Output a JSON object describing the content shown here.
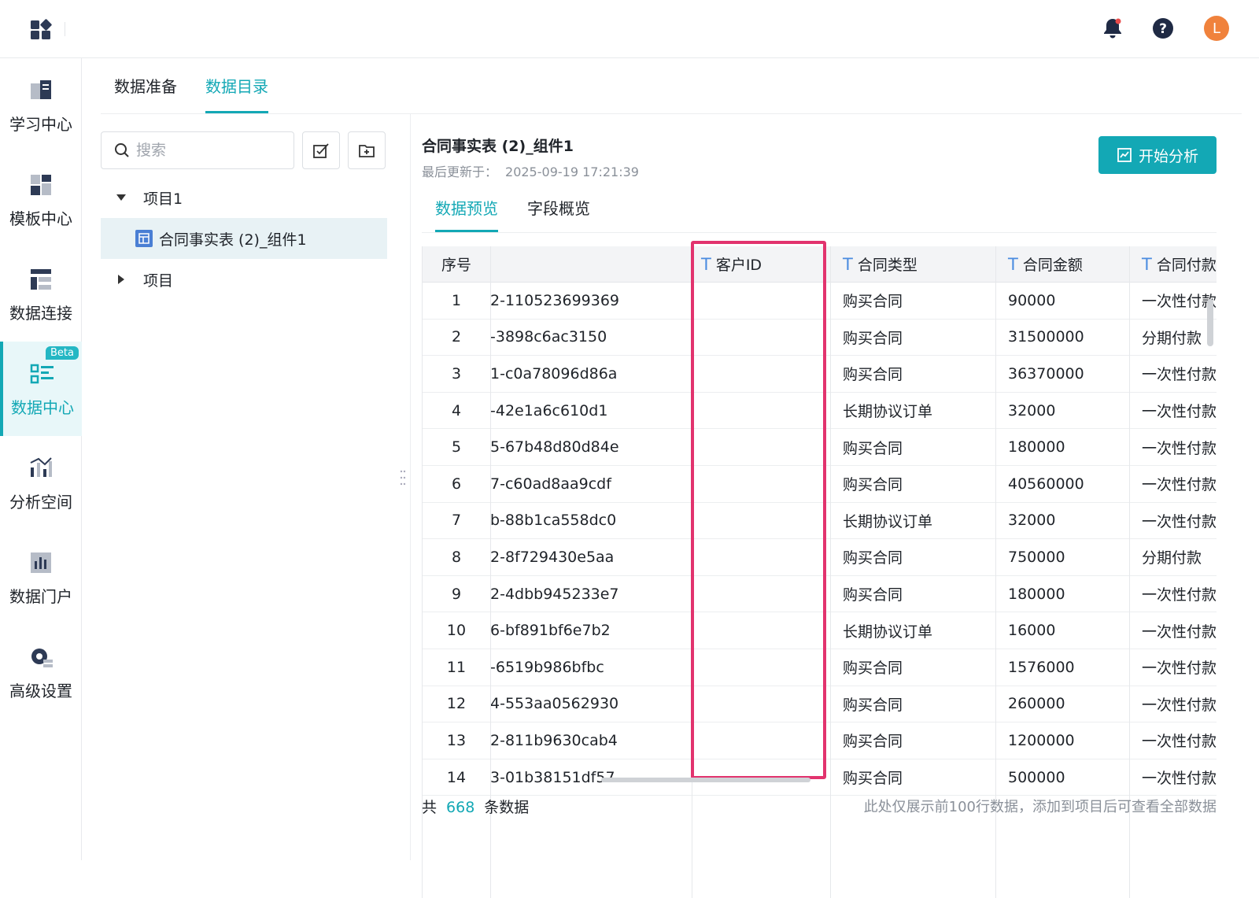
{
  "header": {
    "avatar_letter": "L"
  },
  "sidebar": {
    "items": [
      {
        "label": "学习中心",
        "icon": "book-icon"
      },
      {
        "label": "模板中心",
        "icon": "template-icon"
      },
      {
        "label": "数据连接",
        "icon": "data-connect-icon"
      },
      {
        "label": "数据中心",
        "icon": "data-center-icon",
        "badge": "Beta",
        "active": true
      },
      {
        "label": "分析空间",
        "icon": "analysis-icon"
      },
      {
        "label": "数据门户",
        "icon": "portal-icon"
      },
      {
        "label": "高级设置",
        "icon": "gear-icon"
      }
    ]
  },
  "top_tabs": [
    {
      "label": "数据准备"
    },
    {
      "label": "数据目录",
      "active": true
    }
  ],
  "left_panel": {
    "search_placeholder": "搜索",
    "tree": [
      {
        "label": "项目1",
        "expanded": true
      },
      {
        "label": "合同事实表 (2)_组件1",
        "selected": true
      },
      {
        "label": "项目",
        "expanded": false
      }
    ]
  },
  "dataset": {
    "title": "合同事实表 (2)_组件1",
    "updated_label": "最后更新于：",
    "updated_time": "2025-09-19 17:21:39",
    "analyze_button": "开始分析",
    "tabs": [
      {
        "label": "数据预览",
        "active": true
      },
      {
        "label": "字段概览"
      }
    ]
  },
  "table": {
    "columns": [
      "序号",
      "",
      "客户ID",
      "合同类型",
      "合同金额",
      "合同付款"
    ],
    "rows": [
      [
        "1",
        "2-110523699369",
        "",
        "购买合同",
        "90000",
        "一次性付款"
      ],
      [
        "2",
        "-3898c6ac3150",
        "",
        "购买合同",
        "31500000",
        "分期付款"
      ],
      [
        "3",
        "1-c0a78096d86a",
        "",
        "购买合同",
        "36370000",
        "一次性付款"
      ],
      [
        "4",
        "-42e1a6c610d1",
        "",
        "长期协议订单",
        "32000",
        "一次性付款"
      ],
      [
        "5",
        "5-67b48d80d84e",
        "",
        "购买合同",
        "180000",
        "一次性付款"
      ],
      [
        "6",
        "7-c60ad8aa9cdf",
        "",
        "购买合同",
        "40560000",
        "一次性付款"
      ],
      [
        "7",
        "b-88b1ca558dc0",
        "",
        "长期协议订单",
        "32000",
        "一次性付款"
      ],
      [
        "8",
        "2-8f729430e5aa",
        "",
        "购买合同",
        "750000",
        "分期付款"
      ],
      [
        "9",
        "2-4dbb945233e7",
        "",
        "购买合同",
        "180000",
        "一次性付款"
      ],
      [
        "10",
        "6-bf891bf6e7b2",
        "",
        "长期协议订单",
        "16000",
        "一次性付款"
      ],
      [
        "11",
        "-6519b986bfbc",
        "",
        "购买合同",
        "1576000",
        "一次性付款"
      ],
      [
        "12",
        "4-553aa0562930",
        "",
        "购买合同",
        "260000",
        "一次性付款"
      ],
      [
        "13",
        "2-811b9630cab4",
        "",
        "购买合同",
        "1200000",
        "一次性付款"
      ],
      [
        "14",
        "3-01b38151df57",
        "",
        "购买合同",
        "500000",
        "一次性付款"
      ]
    ]
  },
  "footer": {
    "prefix": "共",
    "count": "668",
    "suffix": "条数据",
    "note": "此处仅展示前100行数据，添加到项目后可查看全部数据"
  },
  "colors": {
    "accent": "#13a8b5",
    "highlight": "#e2336e",
    "avatar": "#f0823c"
  }
}
